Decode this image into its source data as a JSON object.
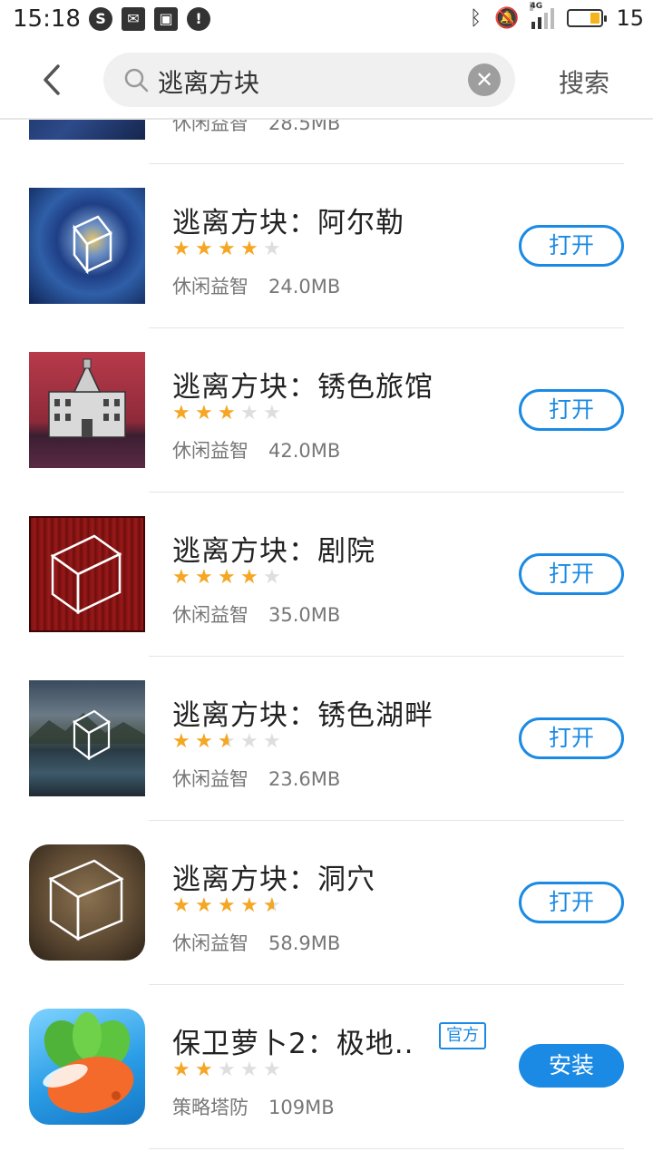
{
  "status_bar": {
    "time": "15:18",
    "battery_level": "15",
    "network_label": "4G"
  },
  "header": {
    "back_icon": "chevron-left-icon",
    "search_value": "逃离方块",
    "search_action": "搜索"
  },
  "partial_item": {
    "meta": "休闲益智",
    "size": "28.5MB"
  },
  "apps": [
    {
      "title": "逃离方块：阿尔勒",
      "rating": 4,
      "category": "休闲益智",
      "size": "24.0MB",
      "button": "打开"
    },
    {
      "title": "逃离方块：锈色旅馆",
      "rating": 3,
      "category": "休闲益智",
      "size": "42.0MB",
      "button": "打开"
    },
    {
      "title": "逃离方块：剧院",
      "rating": 4,
      "category": "休闲益智",
      "size": "35.0MB",
      "button": "打开"
    },
    {
      "title": "逃离方块：锈色湖畔",
      "rating": 2.5,
      "category": "休闲益智",
      "size": "23.6MB",
      "button": "打开"
    },
    {
      "title": "逃离方块：洞穴",
      "rating": 4.5,
      "category": "休闲益智",
      "size": "58.9MB",
      "button": "打开"
    },
    {
      "title": "保卫萝卜2：极地..",
      "badge": "官方",
      "rating": 2,
      "category": "策略塔防",
      "size": "109MB",
      "button": "安装"
    }
  ],
  "colors": {
    "accent": "#1a8ae4",
    "star": "#f5a623",
    "star_empty": "#dedede"
  }
}
